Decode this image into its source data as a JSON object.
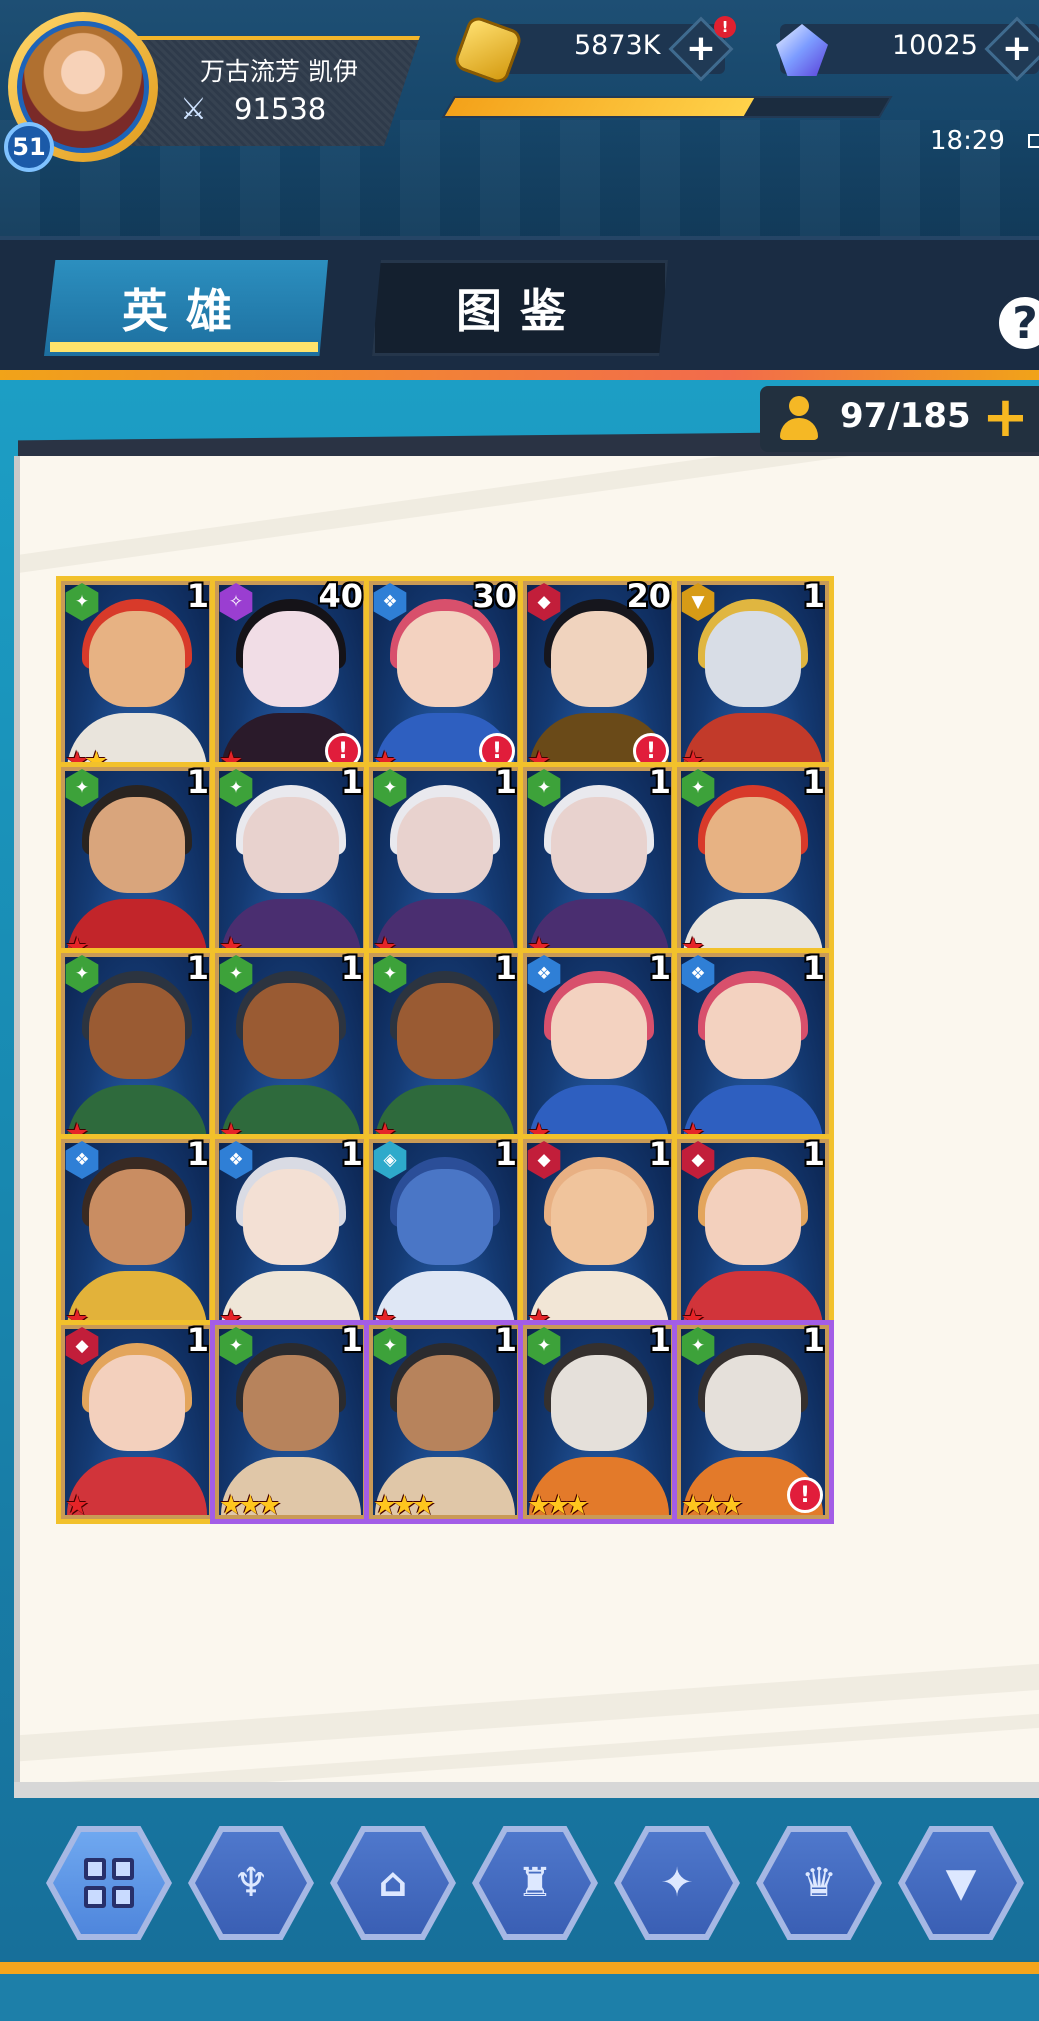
{
  "player": {
    "name": "万古流芳 凯伊",
    "level": "51",
    "power": "91538"
  },
  "resources": {
    "gold": "5873K",
    "gold_alert": "!",
    "gems": "10025",
    "plus": "+",
    "exp_fill_fraction": 0.69
  },
  "status": {
    "time": "18:29"
  },
  "tabs": [
    {
      "label": "英雄",
      "active": true
    },
    {
      "label": "图鉴",
      "active": false
    }
  ],
  "help_label": "?",
  "capacity": {
    "text": "97/185",
    "plus": "+"
  },
  "hero_cards": [
    {
      "faction": "green",
      "level": "1",
      "stars": 2,
      "star_colors": [
        "red",
        "gold"
      ],
      "alert": false,
      "portrait": "red-hair-warrior"
    },
    {
      "faction": "purple",
      "level": "40",
      "stars": 1,
      "star_colors": [
        "red"
      ],
      "alert": true,
      "portrait": "dark-queen"
    },
    {
      "faction": "blue",
      "level": "30",
      "stars": 1,
      "star_colors": [
        "red"
      ],
      "alert": true,
      "portrait": "pink-hair-girl"
    },
    {
      "faction": "red",
      "level": "20",
      "stars": 1,
      "star_colors": [
        "red"
      ],
      "alert": true,
      "portrait": "black-hair-swordswoman"
    },
    {
      "faction": "gold",
      "level": "1",
      "stars": 1,
      "star_colors": [
        "red"
      ],
      "alert": false,
      "portrait": "golden-knight"
    },
    {
      "faction": "green",
      "level": "1",
      "stars": 1,
      "star_colors": [
        "red"
      ],
      "alert": false,
      "portrait": "ninja-boy"
    },
    {
      "faction": "green",
      "level": "1",
      "stars": 1,
      "star_colors": [
        "red"
      ],
      "alert": false,
      "portrait": "white-hair-witch"
    },
    {
      "faction": "green",
      "level": "1",
      "stars": 1,
      "star_colors": [
        "red"
      ],
      "alert": false,
      "portrait": "white-hair-witch"
    },
    {
      "faction": "green",
      "level": "1",
      "stars": 1,
      "star_colors": [
        "red"
      ],
      "alert": false,
      "portrait": "white-hair-witch"
    },
    {
      "faction": "green",
      "level": "1",
      "stars": 1,
      "star_colors": [
        "red"
      ],
      "alert": false,
      "portrait": "red-hair-warrior"
    },
    {
      "faction": "green",
      "level": "1",
      "stars": 1,
      "star_colors": [
        "red"
      ],
      "alert": false,
      "portrait": "helmet-otter"
    },
    {
      "faction": "green",
      "level": "1",
      "stars": 1,
      "star_colors": [
        "red"
      ],
      "alert": false,
      "portrait": "helmet-otter"
    },
    {
      "faction": "green",
      "level": "1",
      "stars": 1,
      "star_colors": [
        "red"
      ],
      "alert": false,
      "portrait": "helmet-otter"
    },
    {
      "faction": "blue",
      "level": "1",
      "stars": 1,
      "star_colors": [
        "red"
      ],
      "alert": false,
      "portrait": "pink-hair-girl"
    },
    {
      "faction": "blue",
      "level": "1",
      "stars": 1,
      "star_colors": [
        "red"
      ],
      "alert": false,
      "portrait": "pink-hair-girl"
    },
    {
      "faction": "blue",
      "level": "1",
      "stars": 1,
      "star_colors": [
        "red"
      ],
      "alert": false,
      "portrait": "pirate-captain"
    },
    {
      "faction": "blue",
      "level": "1",
      "stars": 1,
      "star_colors": [
        "red"
      ],
      "alert": false,
      "portrait": "elf-pirate-girl"
    },
    {
      "faction": "cyan",
      "level": "1",
      "stars": 1,
      "star_colors": [
        "red"
      ],
      "alert": false,
      "portrait": "blue-beast"
    },
    {
      "faction": "red",
      "level": "1",
      "stars": 1,
      "star_colors": [
        "red"
      ],
      "alert": false,
      "portrait": "rabbit-monk"
    },
    {
      "faction": "red",
      "level": "1",
      "stars": 1,
      "star_colors": [
        "red"
      ],
      "alert": false,
      "portrait": "blonde-girl"
    },
    {
      "faction": "red",
      "level": "1",
      "stars": 1,
      "star_colors": [
        "red"
      ],
      "alert": false,
      "portrait": "blonde-girl"
    },
    {
      "faction": "green",
      "level": "1",
      "stars": 3,
      "star_colors": [
        "gold",
        "gold",
        "gold"
      ],
      "alert": false,
      "portrait": "spiky-hair-boy",
      "frame": "purple"
    },
    {
      "faction": "green",
      "level": "1",
      "stars": 3,
      "star_colors": [
        "gold",
        "gold",
        "gold"
      ],
      "alert": false,
      "portrait": "spiky-hair-boy",
      "frame": "purple"
    },
    {
      "faction": "green",
      "level": "1",
      "stars": 3,
      "star_colors": [
        "gold",
        "gold",
        "gold"
      ],
      "alert": false,
      "portrait": "wolf-warrior",
      "frame": "purple"
    },
    {
      "faction": "green",
      "level": "1",
      "stars": 3,
      "star_colors": [
        "gold",
        "gold",
        "gold"
      ],
      "alert": true,
      "portrait": "wolf-warrior",
      "frame": "purple"
    }
  ],
  "alert_mark": "!",
  "filters": [
    {
      "icon": "all-grid-icon",
      "active": true
    },
    {
      "icon": "faction-blue-icon",
      "active": false
    },
    {
      "icon": "faction-cyan-icon",
      "active": false
    },
    {
      "icon": "faction-purple-icon",
      "active": false
    },
    {
      "icon": "faction-green-icon",
      "active": false
    },
    {
      "icon": "faction-red-icon",
      "active": false
    },
    {
      "icon": "faction-gold-icon",
      "active": false
    }
  ],
  "colors": {
    "accent_orange": "#f1a319",
    "card_gold_frame": "#f2c12b",
    "card_purple_frame": "#a35de6",
    "star_red": "#e52428",
    "star_gold": "#ffc61e",
    "tab_active": "#2c8fbf"
  }
}
